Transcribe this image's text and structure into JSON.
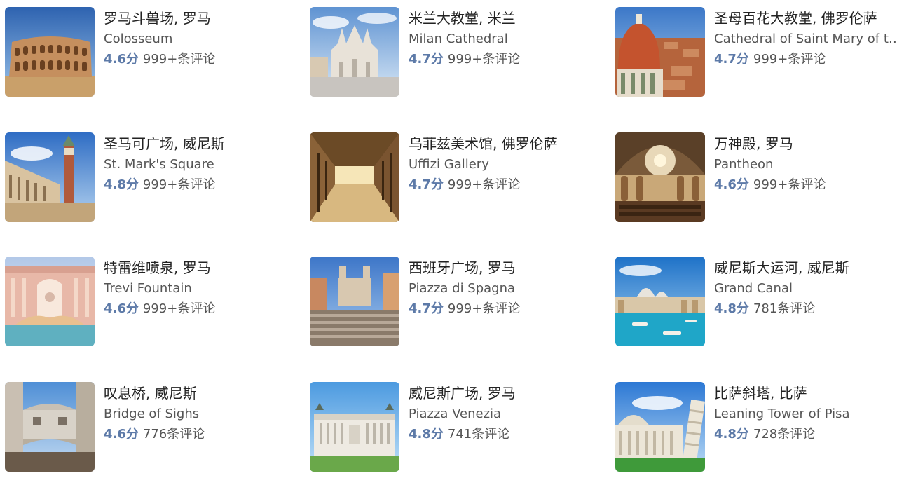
{
  "attractions": [
    {
      "name_cn": "罗马斗兽场, 罗马",
      "name_en": "Colosseum",
      "score": "4.6分",
      "reviews": "999+条评论",
      "sky": "#4f86c6",
      "ground": "#c9a06a",
      "building": "#c58f5e",
      "icon": "colosseum-photo"
    },
    {
      "name_cn": "米兰大教堂, 米兰",
      "name_en": "Milan Cathedral",
      "score": "4.7分",
      "reviews": "999+条评论",
      "sky": "#8fb7e0",
      "ground": "#c8c4bf",
      "building": "#e8e2d8",
      "icon": "cathedral-photo"
    },
    {
      "name_cn": "圣母百花大教堂, 佛罗伦萨",
      "name_en": "Cathedral of Saint Mary of the Flower",
      "score": "4.7分",
      "reviews": "999+条评论",
      "sky": "#5d92d6",
      "ground": "#b5643c",
      "building": "#c4532e",
      "icon": "dome-photo"
    },
    {
      "name_cn": "圣马可广场, 威尼斯",
      "name_en": "St. Mark's Square",
      "score": "4.8分",
      "reviews": "999+条评论",
      "sky": "#3f7fd0",
      "ground": "#c2a57a",
      "building": "#d9c3a0",
      "icon": "bell-tower-photo"
    },
    {
      "name_cn": "乌菲兹美术馆, 佛罗伦萨",
      "name_en": "Uffizi Gallery",
      "score": "4.7分",
      "reviews": "999+条评论",
      "sky": "#6b4a26",
      "ground": "#d8b880",
      "building": "#4a3218",
      "icon": "gallery-photo"
    },
    {
      "name_cn": "万神殿, 罗马",
      "name_en": "Pantheon",
      "score": "4.6分",
      "reviews": "999+条评论",
      "sky": "#7a5a3a",
      "ground": "#5a3a22",
      "building": "#c9a878",
      "icon": "pantheon-photo"
    },
    {
      "name_cn": "特雷维喷泉, 罗马",
      "name_en": "Trevi Fountain",
      "score": "4.6分",
      "reviews": "999+条评论",
      "sky": "#c9d8ee",
      "ground": "#5fb0c0",
      "building": "#e8b8a8",
      "icon": "fountain-photo"
    },
    {
      "name_cn": "西班牙广场, 罗马",
      "name_en": "Piazza di Spagna",
      "score": "4.7分",
      "reviews": "999+条评论",
      "sky": "#4d85d0",
      "ground": "#8a7a6a",
      "building": "#d8c8b0",
      "icon": "steps-photo"
    },
    {
      "name_cn": "威尼斯大运河, 威尼斯",
      "name_en": "Grand Canal",
      "score": "4.8分",
      "reviews": "781条评论",
      "sky": "#3f93d8",
      "ground": "#1fa6c8",
      "building": "#d9c7a8",
      "icon": "canal-photo"
    },
    {
      "name_cn": "叹息桥, 威尼斯",
      "name_en": "Bridge of Sighs",
      "score": "4.6分",
      "reviews": "776条评论",
      "sky": "#7ab0e0",
      "ground": "#6a5a4a",
      "building": "#d8d2c8",
      "icon": "bridge-photo"
    },
    {
      "name_cn": "威尼斯广场, 罗马",
      "name_en": "Piazza Venezia",
      "score": "4.8分",
      "reviews": "741条评论",
      "sky": "#6aaee8",
      "ground": "#6aa84a",
      "building": "#eeeae2",
      "icon": "monument-photo"
    },
    {
      "name_cn": "比萨斜塔, 比萨",
      "name_en": "Leaning Tower of Pisa",
      "score": "4.8分",
      "reviews": "728条评论",
      "sky": "#3f86dc",
      "ground": "#3f9a3a",
      "building": "#ece6d8",
      "icon": "tower-photo"
    }
  ]
}
